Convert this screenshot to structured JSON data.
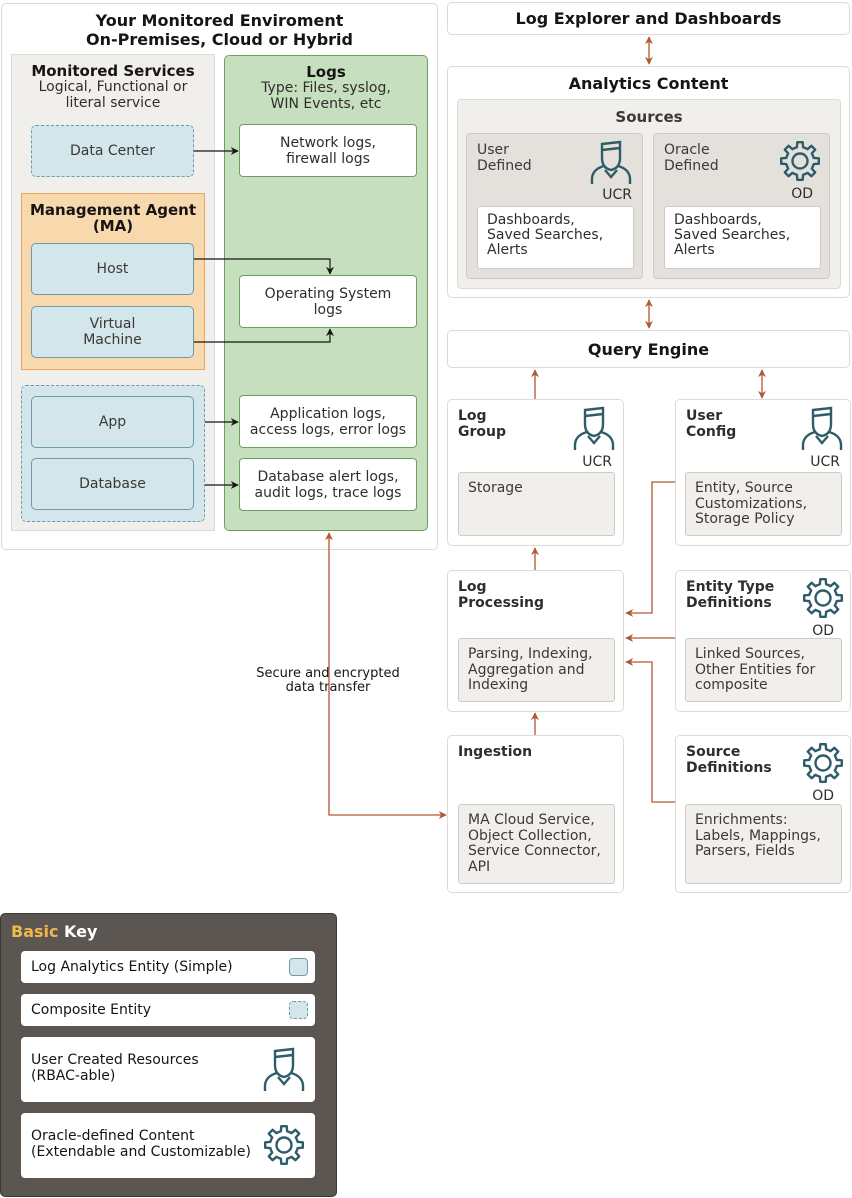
{
  "monitored_env": {
    "title_line1": "Your Monitored Enviroment",
    "title_line2": "On-Premises, Cloud or Hybrid",
    "services": {
      "title": "Monitored Services",
      "subtitle_line1": "Logical, Functional or",
      "subtitle_line2": "literal service",
      "data_center": "Data Center",
      "management_agent_line1": "Management Agent",
      "management_agent_line2": "(MA)",
      "host": "Host",
      "vm_line1": "Virtual",
      "vm_line2": "Machine",
      "app": "App",
      "database": "Database"
    },
    "logs": {
      "title": "Logs",
      "subtitle_line1": "Type: Files, syslog,",
      "subtitle_line2": "WIN Events, etc",
      "network_line1": "Network logs,",
      "network_line2": "firewall logs",
      "os_line1": "Operating System",
      "os_line2": "logs",
      "app_line1": "Application logs,",
      "app_line2": "access logs, error logs",
      "db_line1": "Database alert logs,",
      "db_line2": "audit logs, trace logs"
    }
  },
  "transfer_label_line1": "Secure and encrypted",
  "transfer_label_line2": "data transfer",
  "log_explorer": "Log Explorer and Dashboards",
  "analytics": {
    "title": "Analytics Content",
    "sources_title": "Sources",
    "user_defined": {
      "line1": "User",
      "line2": "Defined",
      "badge": "UCR",
      "content": [
        "Dashboards,",
        "Saved Searches,",
        "Alerts"
      ]
    },
    "oracle_defined": {
      "line1": "Oracle",
      "line2": "Defined",
      "badge": "OD",
      "content": [
        "Dashboards,",
        "Saved Searches,",
        "Alerts"
      ]
    }
  },
  "query_engine": "Query Engine",
  "log_group": {
    "line1": "Log",
    "line2": "Group",
    "badge": "UCR",
    "content": [
      "Storage"
    ]
  },
  "user_config": {
    "line1": "User",
    "line2": "Config",
    "badge": "UCR",
    "content": [
      "Entity, Source",
      "Customizations,",
      "Storage Policy"
    ]
  },
  "log_processing": {
    "line1": "Log",
    "line2": "Processing",
    "content": [
      "Parsing, Indexing,",
      "Aggregation and",
      "Indexing"
    ]
  },
  "entity_type_defs": {
    "line1": "Entity Type",
    "line2": "Definitions",
    "badge": "OD",
    "content": [
      "Linked Sources,",
      "Other Entities for",
      "composite"
    ]
  },
  "ingestion": {
    "line1": "Ingestion",
    "content": [
      "MA Cloud Service,",
      "Object Collection,",
      "Service Connector,",
      "API"
    ]
  },
  "source_defs": {
    "line1": "Source",
    "line2": "Definitions",
    "badge": "OD",
    "content": [
      "Enrichments:",
      "Labels, Mappings,",
      "Parsers, Fields"
    ]
  },
  "key": {
    "title_accent": "Basic",
    "title_rest": " Key",
    "accent_color": "#f0b94c",
    "items": [
      {
        "line1": "Log Analytics Entity (Simple)",
        "icon": "simple-entity-swatch"
      },
      {
        "line1": "Composite Entity",
        "icon": "composite-entity-swatch"
      },
      {
        "line1": "User Created Resources",
        "line2": "(RBAC-able)",
        "icon": "user-icon"
      },
      {
        "line1": "Oracle-defined Content",
        "line2": "(Extendable and Customizable)",
        "icon": "gear-icon"
      }
    ]
  },
  "colors": {
    "arrow_brown": "#b0582f",
    "icon_teal": "#2f5c69",
    "logs_green": "#c6dfbf",
    "entity_blue": "#d3e6ec",
    "agent_orange": "#f8d9ae"
  }
}
